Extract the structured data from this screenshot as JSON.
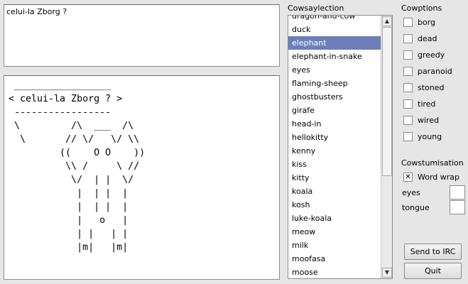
{
  "input": {
    "text": "celui-la Zborg ?"
  },
  "output": {
    "cow_art": " _________________\n< celui-la Zborg ? >\n -----------------\n \\         /\\  ___  /\\\n  \\       // \\/   \\/ \\\\\n         ((    O O    ))\n          \\\\ /     \\ //\n           \\/  | |  \\/\n            |  | |  |\n            |  | |  |\n            |   o   |\n            | |   | |\n            |m|   |m|"
  },
  "cowselection": {
    "title": "Cowsaylection",
    "items": [
      "dragon-and-cow",
      "duck",
      "elephant",
      "elephant-in-snake",
      "eyes",
      "flaming-sheep",
      "ghostbusters",
      "girafe",
      "head-in",
      "hellokitty",
      "kenny",
      "kiss",
      "kitty",
      "koala",
      "kosh",
      "luke-koala",
      "meow",
      "milk",
      "moofasa",
      "moose"
    ],
    "selected": "elephant",
    "scroll_up": "▲",
    "scroll_down": "▼"
  },
  "options": {
    "title": "Cowptions",
    "items": [
      {
        "label": "borg",
        "checked": false
      },
      {
        "label": "dead",
        "checked": false
      },
      {
        "label": "greedy",
        "checked": false
      },
      {
        "label": "paranoid",
        "checked": false
      },
      {
        "label": "stoned",
        "checked": false
      },
      {
        "label": "tired",
        "checked": false
      },
      {
        "label": "wired",
        "checked": false
      },
      {
        "label": "young",
        "checked": false
      }
    ]
  },
  "customisation": {
    "title": "Cowstumisation",
    "word_wrap": {
      "label": "Word wrap",
      "checked": true
    },
    "eyes_label": "eyes",
    "eyes_value": "",
    "tongue_label": "tongue",
    "tongue_value": ""
  },
  "buttons": {
    "send": "Send to IRC",
    "quit": "Quit"
  }
}
